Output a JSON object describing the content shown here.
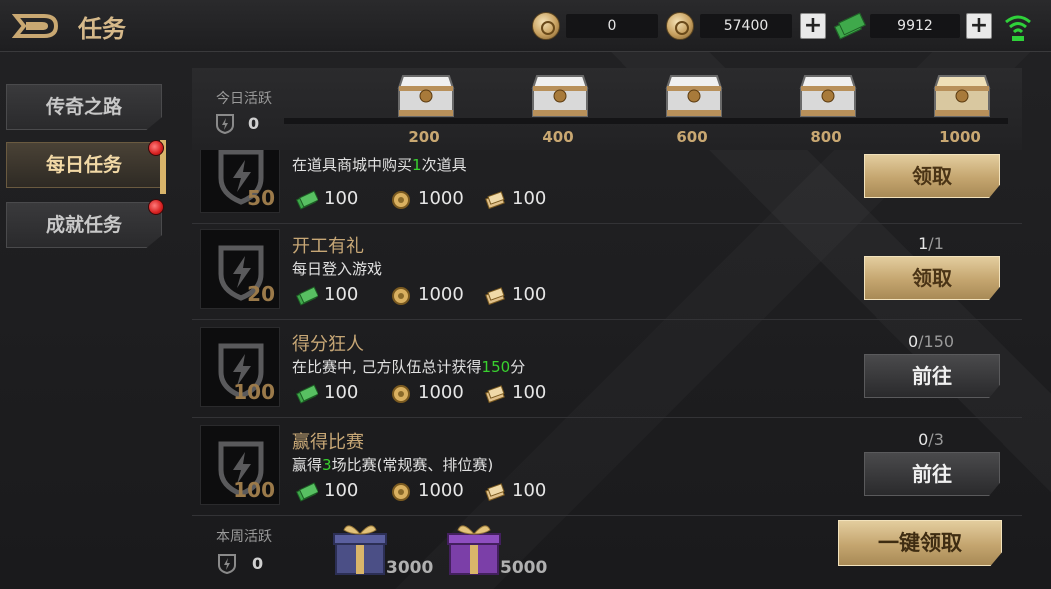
{
  "header": {
    "title": "任务",
    "currencies": [
      {
        "icon": "basketball-coin-icon",
        "value": "0"
      },
      {
        "icon": "gold-coin-icon",
        "value": "57400"
      },
      {
        "icon": "cash-icon",
        "value": "9912"
      }
    ],
    "plus_symbol": "+"
  },
  "nav": [
    {
      "label": "传奇之路",
      "active": false,
      "badge": false
    },
    {
      "label": "每日任务",
      "active": true,
      "badge": true
    },
    {
      "label": "成就任务",
      "active": false,
      "badge": true
    }
  ],
  "daily_activity": {
    "label": "今日活跃",
    "value": "0",
    "milestones": [
      "200",
      "400",
      "600",
      "800",
      "1000"
    ]
  },
  "tasks": [
    {
      "name": "",
      "desc_pre": "在道具商城中购买",
      "desc_hl": "1",
      "desc_post": "次道具",
      "points": "50",
      "rewards": [
        "100",
        "1000",
        "100"
      ],
      "progress_done": "",
      "progress_sep": "",
      "progress_total": "",
      "button": "领取",
      "button_style": "gold"
    },
    {
      "name": "开工有礼",
      "desc_pre": "每日登入游戏",
      "desc_hl": "",
      "desc_post": "",
      "points": "20",
      "rewards": [
        "100",
        "1000",
        "100"
      ],
      "progress_done": "1",
      "progress_sep": "/",
      "progress_total": "1",
      "button": "领取",
      "button_style": "gold"
    },
    {
      "name": "得分狂人",
      "desc_pre": "在比赛中, 己方队伍总计获得",
      "desc_hl": "150",
      "desc_post": "分",
      "points": "100",
      "rewards": [
        "100",
        "1000",
        "100"
      ],
      "progress_done": "0",
      "progress_sep": "/",
      "progress_total": "150",
      "button": "前往",
      "button_style": "dark"
    },
    {
      "name": "赢得比赛",
      "desc_pre": "赢得",
      "desc_hl": "3",
      "desc_post": "场比赛(常规赛、排位赛)",
      "points": "100",
      "rewards": [
        "100",
        "1000",
        "100"
      ],
      "progress_done": "0",
      "progress_sep": "/",
      "progress_total": "3",
      "button": "前往",
      "button_style": "dark"
    }
  ],
  "weekly_activity": {
    "label": "本周活跃",
    "value": "0",
    "gifts": [
      "3000",
      "5000"
    ],
    "claim_all": "一键领取"
  },
  "colors": {
    "accent_gold": "#c4a56f",
    "highlight_green": "#39d12f",
    "badge_red": "#d62020"
  }
}
